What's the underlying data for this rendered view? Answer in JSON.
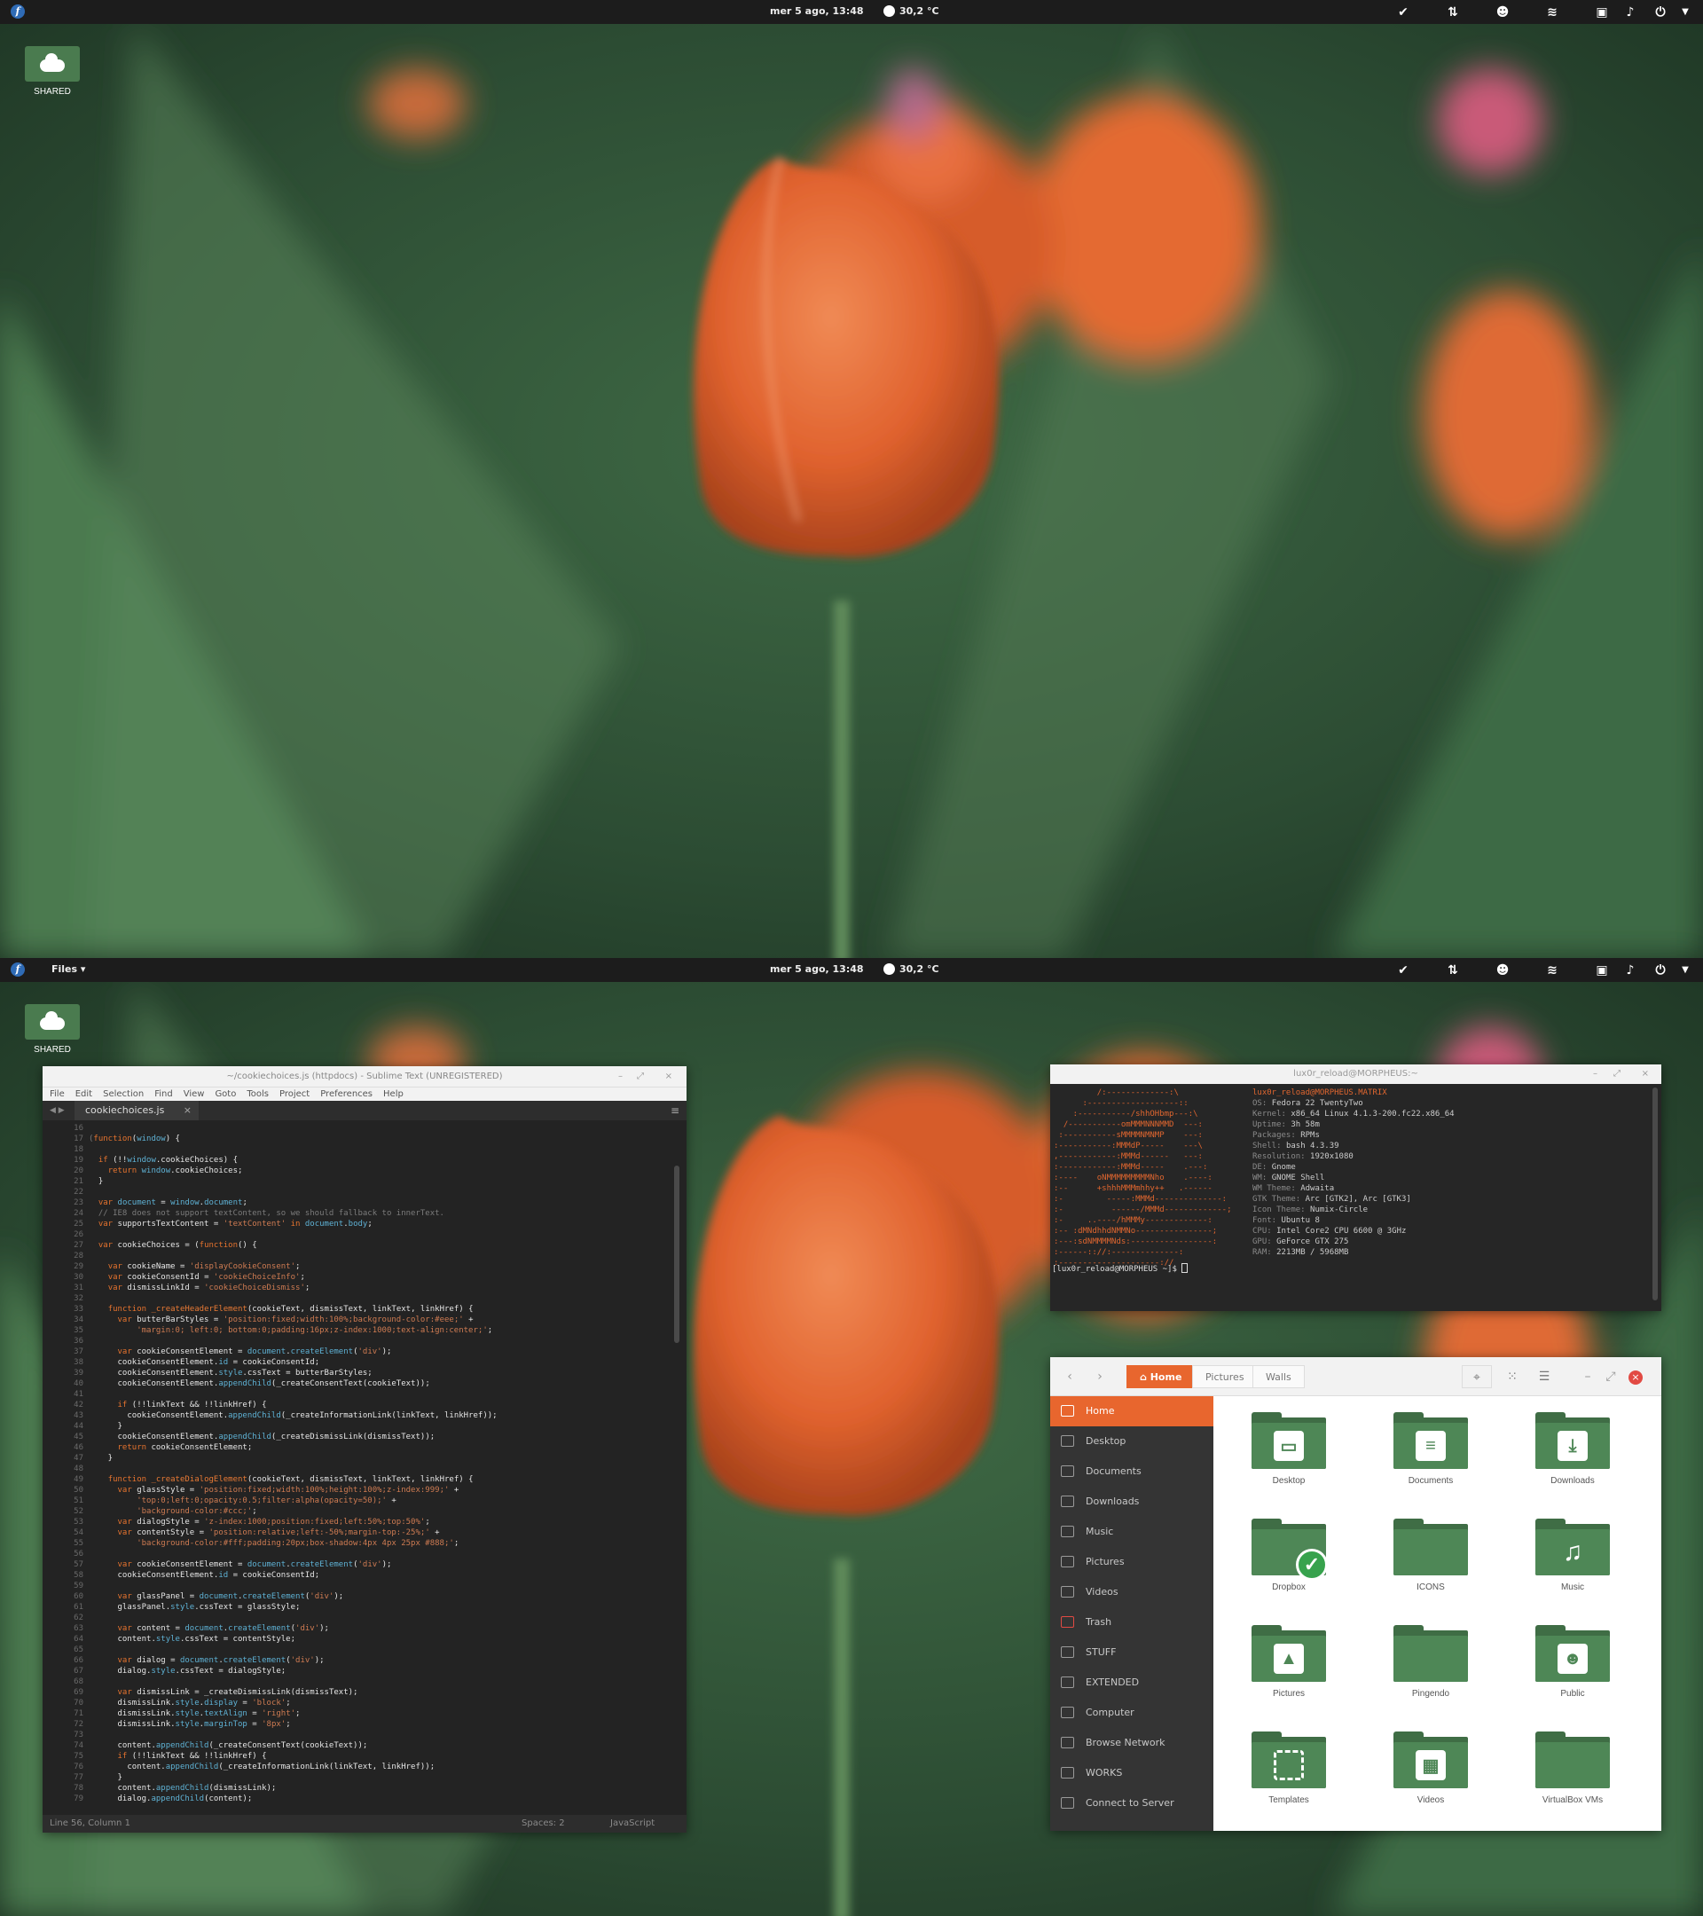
{
  "topbar": {
    "clock": "mer  5 ago, 13:48",
    "weather": "30,2 °C",
    "app_menu": "Files ▾",
    "fedora_glyph": "f"
  },
  "desktop": {
    "shared_label": "SHARED"
  },
  "sublime": {
    "title": "~/cookiechoices.js (httpdocs) - Sublime Text (UNREGISTERED)",
    "menu": [
      "File",
      "Edit",
      "Selection",
      "Find",
      "View",
      "Goto",
      "Tools",
      "Project",
      "Preferences",
      "Help"
    ],
    "tab": "cookiechoices.js",
    "status_left": "Line 56, Column 1",
    "status_spaces": "Spaces: 2",
    "status_syntax": "JavaScript",
    "first_line": 16,
    "last_line": 79
  },
  "terminal": {
    "title": "lux0r_reload@MORPHEUS:~",
    "prompt": "[lux0r_reload@MORPHEUS ~]$ ",
    "user": "lux0r_reload@MORPHEUS.MATRIX",
    "info": [
      {
        "k": "OS:",
        "v": "Fedora 22 TwentyTwo"
      },
      {
        "k": "Kernel:",
        "v": "x86_64 Linux 4.1.3-200.fc22.x86_64"
      },
      {
        "k": "Uptime:",
        "v": "3h 58m"
      },
      {
        "k": "Packages:",
        "v": "RPMs"
      },
      {
        "k": "Shell:",
        "v": "bash 4.3.39"
      },
      {
        "k": "Resolution:",
        "v": "1920x1080"
      },
      {
        "k": "DE:",
        "v": "Gnome"
      },
      {
        "k": "WM:",
        "v": "GNOME Shell"
      },
      {
        "k": "WM Theme:",
        "v": "Adwaita"
      },
      {
        "k": "GTK Theme:",
        "v": "Arc [GTK2], Arc [GTK3]"
      },
      {
        "k": "Icon Theme:",
        "v": "Numix-Circle"
      },
      {
        "k": "Font:",
        "v": "Ubuntu 8"
      },
      {
        "k": "CPU:",
        "v": "Intel Core2 CPU 6600 @ 3GHz"
      },
      {
        "k": "GPU:",
        "v": "GeForce GTX 275"
      },
      {
        "k": "RAM:",
        "v": "2213MB / 5968MB"
      }
    ]
  },
  "files": {
    "breadcrumbs": [
      "Home",
      "Pictures",
      "Walls"
    ],
    "sidebar": [
      "Home",
      "Desktop",
      "Documents",
      "Downloads",
      "Music",
      "Pictures",
      "Videos",
      "Trash",
      "STUFF",
      "EXTENDED",
      "Computer",
      "Browse Network",
      "WORKS",
      "Connect to Server"
    ],
    "items": [
      {
        "label": "Desktop",
        "icon": "desktop-icon"
      },
      {
        "label": "Documents",
        "icon": "document-icon"
      },
      {
        "label": "Downloads",
        "icon": "download-icon"
      },
      {
        "label": "Dropbox",
        "icon": "check-icon"
      },
      {
        "label": "ICONS",
        "icon": ""
      },
      {
        "label": "Music",
        "icon": "music-icon"
      },
      {
        "label": "Pictures",
        "icon": "picture-icon"
      },
      {
        "label": "Pingendo",
        "icon": ""
      },
      {
        "label": "Public",
        "icon": "people-icon"
      },
      {
        "label": "Templates",
        "icon": "template-icon"
      },
      {
        "label": "Videos",
        "icon": "film-icon"
      },
      {
        "label": "VirtualBox VMs",
        "icon": ""
      }
    ]
  },
  "colors": {
    "accent": "#e8662e",
    "folder": "#4e8756",
    "folder_dark": "#3f6d45",
    "sidebar": "#343434",
    "topbar": "#1c1c1c"
  }
}
